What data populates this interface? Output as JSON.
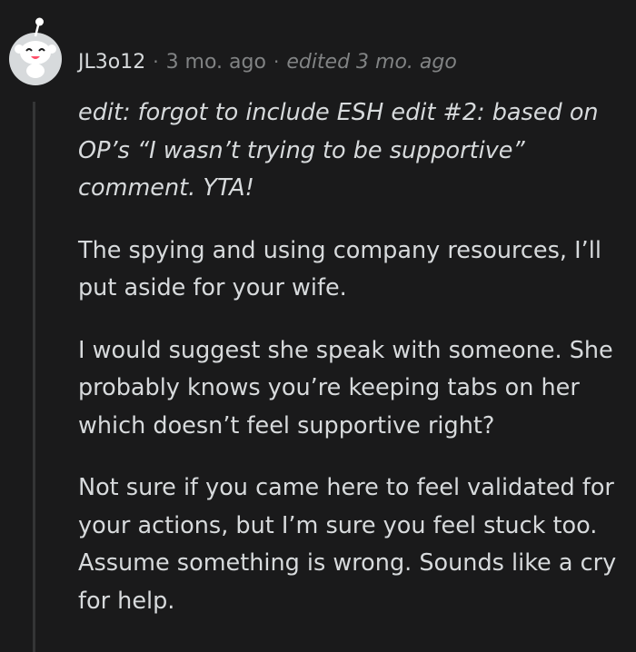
{
  "comment": {
    "avatar_icon": "snoo-avatar-icon",
    "username": "JL3o12",
    "separator": "·",
    "age": "3 mo. ago",
    "edited": "edited 3 mo. ago",
    "paragraphs": [
      "edit: forgot to include ESH edit #2: based on OP’s “I wasn’t trying to be supportive” comment. YTA!",
      "The spying and using company resources, I’ll put aside for your wife.",
      "I would suggest she speak with someone. She probably knows you’re keeping tabs on her which doesn’t feel supportive right?",
      "Not sure if you came here to feel validated for your actions, but I’m sure you feel stuck too. Assume something is wrong. Sounds like a cry for help."
    ]
  },
  "colors": {
    "background": "#1a1a1b",
    "text": "#d7dadc",
    "meta": "#818384",
    "thread_line": "#343536"
  }
}
